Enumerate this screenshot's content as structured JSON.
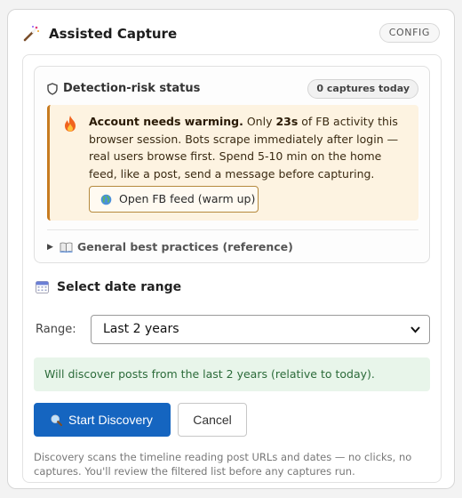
{
  "header": {
    "title": "Assisted Capture",
    "badge": "CONFIG"
  },
  "detection": {
    "title": "Detection-risk status",
    "captures_badge": "0 captures today",
    "warning": {
      "heading": "Account needs warming.",
      "text_before_value": " Only ",
      "value": "23s",
      "text_after_value": " of FB activity this browser session. Bots scrape immediately after login — real users browse first. Spend 5-10 min on the home feed, like a post, send a message before capturing.",
      "button_label": "Open FB feed (warm up)"
    },
    "practices_label": "General best practices (reference)"
  },
  "date_range": {
    "title": "Select date range",
    "range_label": "Range:",
    "selected_value": "Last 2 years",
    "info_text": "Will discover posts from the last 2 years (relative to today)."
  },
  "actions": {
    "start_label": "Start Discovery",
    "cancel_label": "Cancel"
  },
  "footnote": "Discovery scans the timeline reading post URLs and dates — no clicks, no captures. You'll review the filtered list before any captures run.",
  "colors": {
    "primary": "#1565c0",
    "warning_bg": "#fdf3e1",
    "warning_border": "#c77b20",
    "info_bg": "#e8f5ea",
    "info_text": "#2c6b3a"
  },
  "icons": [
    "magic-wand-icon",
    "shield-icon",
    "fire-icon",
    "globe-icon",
    "book-icon",
    "calendar-icon",
    "search-icon",
    "chevron-down-icon"
  ]
}
